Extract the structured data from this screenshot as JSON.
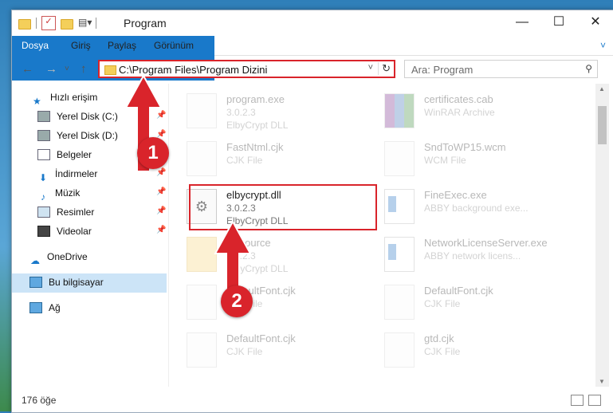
{
  "window": {
    "title": "Program"
  },
  "controls": {
    "minimize": "—",
    "maximize": "☐",
    "close": "✕"
  },
  "ribbon": {
    "tabs": [
      "Dosya",
      "Giriş",
      "Paylaş",
      "Görünüm"
    ]
  },
  "address": {
    "path": "C:\\Program Files\\Program Dizini"
  },
  "search": {
    "placeholder": "Ara: Program"
  },
  "nav": {
    "items": [
      {
        "label": "Hızlı erişim"
      },
      {
        "label": "Yerel Disk (C:)"
      },
      {
        "label": "Yerel Disk (D:)"
      },
      {
        "label": "Belgeler"
      },
      {
        "label": "İndirmeler"
      },
      {
        "label": "Müzik"
      },
      {
        "label": "Resimler"
      },
      {
        "label": "Videolar"
      },
      {
        "label": "OneDrive"
      },
      {
        "label": "Bu bilgisayar"
      },
      {
        "label": "Ağ"
      }
    ]
  },
  "files": [
    {
      "name": "program.exe",
      "l2": "3.0.2.3",
      "l3": "ElbyCrypt DLL"
    },
    {
      "name": "certificates.cab",
      "l2": "WinRAR Archive",
      "l3": ""
    },
    {
      "name": "FastNtml.cjk",
      "l2": "CJK File",
      "l3": ""
    },
    {
      "name": "SndToWP15.wcm",
      "l2": "WCM File",
      "l3": ""
    },
    {
      "name": "elbycrypt.dll",
      "l2": "3.0.2.3",
      "l3": "ElbyCrypt DLL"
    },
    {
      "name": "FineExec.exe",
      "l2": "ABBY background exe...",
      "l3": ""
    },
    {
      "name": "Resource",
      "l2": "3.0.2.3",
      "l3": "ElbyCrypt DLL"
    },
    {
      "name": "NetworkLicenseServer.exe",
      "l2": "ABBY network licens...",
      "l3": ""
    },
    {
      "name": "DefaultFont.cjk",
      "l2": "CJK File",
      "l3": ""
    },
    {
      "name": "DefaultFont.cjk",
      "l2": "CJK File",
      "l3": ""
    },
    {
      "name": "DefaultFont.cjk",
      "l2": "CJK File",
      "l3": ""
    },
    {
      "name": "gtd.cjk",
      "l2": "CJK File",
      "l3": ""
    }
  ],
  "status": {
    "count": "176 öğe"
  },
  "annotations": {
    "step1": "1",
    "step2": "2"
  },
  "colors": {
    "accent": "#1979ca",
    "highlight": "#d9242b",
    "selection": "#cce4f7"
  }
}
